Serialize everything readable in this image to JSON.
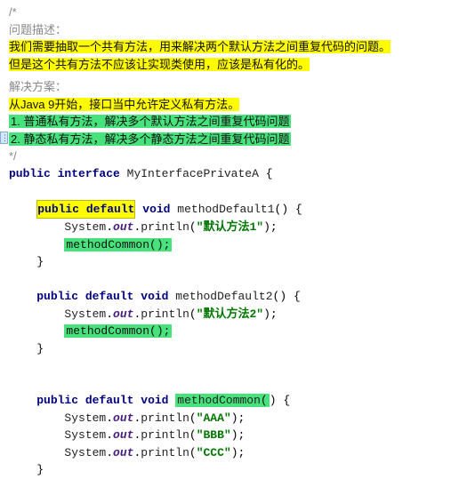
{
  "comment_marker": "/*",
  "section1": {
    "title": "问题描述：",
    "line1": "我们需要抽取一个共有方法，用来解决两个默认方法之间重复代码的问题。",
    "line2": "但是这个共有方法不应该让实现类使用，应该是私有化的。"
  },
  "section2": {
    "title": "解决方案：",
    "intro": "从Java 9开始，接口当中允许定义私有方法。",
    "item1": "1. 普通私有方法，解决多个默认方法之间重复代码问题",
    "item2": "2. 静态私有方法，解决多个静态方法之间重复代码问题"
  },
  "close_comment": " */",
  "code": {
    "kw_public": "public",
    "kw_interface": "interface",
    "kw_default": "default",
    "kw_void": "void",
    "interface_name": "MyInterfacePrivateA",
    "method1": "methodDefault1",
    "method2": "methodDefault2",
    "method_common": "methodCommon",
    "system": "System",
    "out": "out",
    "println": "println",
    "str_m1": "\"默认方法1\"",
    "str_m2": "\"默认方法2\"",
    "str_aaa": "\"AAA\"",
    "str_bbb": "\"BBB\"",
    "str_ccc": "\"CCC\"",
    "common_call": "methodCommon();",
    "brace_open": "{",
    "brace_close": "}",
    "paren_empty": "()",
    "semi": ";"
  }
}
